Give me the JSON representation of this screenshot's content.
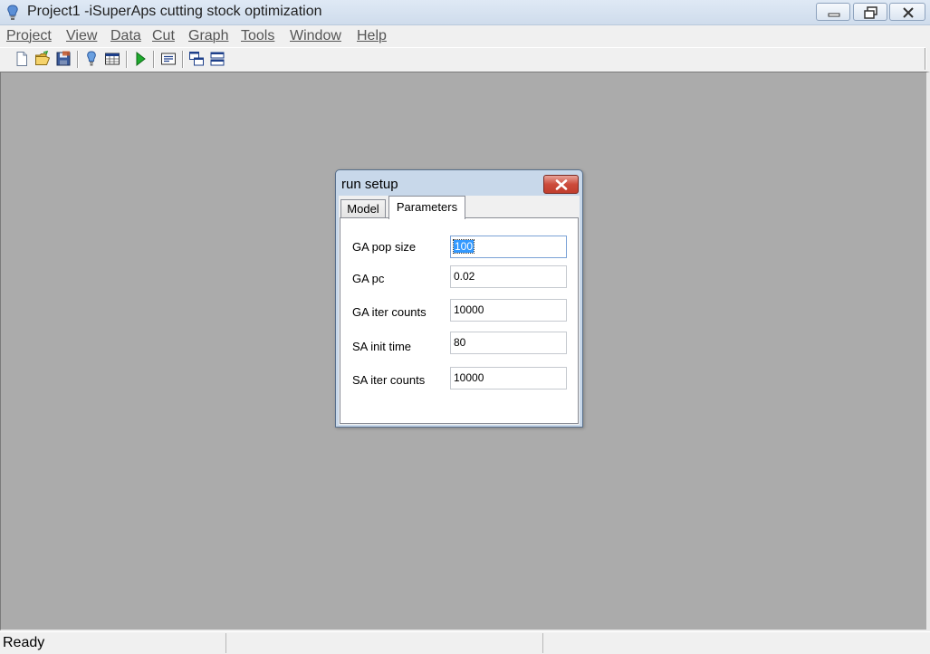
{
  "window": {
    "title": "Project1 -iSuperAps cutting stock optimization",
    "icon": "app-bulb-icon"
  },
  "menu": [
    {
      "label": "Project"
    },
    {
      "label": "View"
    },
    {
      "label": "Data"
    },
    {
      "label": "Cut"
    },
    {
      "label": "Graph"
    },
    {
      "label": "Tools"
    },
    {
      "label": "Window"
    },
    {
      "label": "Help"
    }
  ],
  "toolbar": {
    "icons": [
      "new-file-icon",
      "open-folder-icon",
      "save-icon",
      "bulb-icon",
      "table-icon",
      "run-icon",
      "list-icon",
      "cascade-icon",
      "tile-icon"
    ]
  },
  "dialog": {
    "title": "run setup",
    "tabs": [
      {
        "label": "Model"
      },
      {
        "label": "Parameters"
      }
    ],
    "active_tab": "Parameters",
    "fields": [
      {
        "label": "GA pop size",
        "value": "100"
      },
      {
        "label": "GA pc",
        "value": "0.02"
      },
      {
        "label": "GA iter counts",
        "value": "10000"
      },
      {
        "label": "SA init time",
        "value": "80"
      },
      {
        "label": "SA iter counts",
        "value": "10000"
      }
    ]
  },
  "status": {
    "text": "Ready"
  },
  "colors": {
    "workspace": "#ababab",
    "close_button": "#c9463a",
    "selection": "#3399ff"
  }
}
